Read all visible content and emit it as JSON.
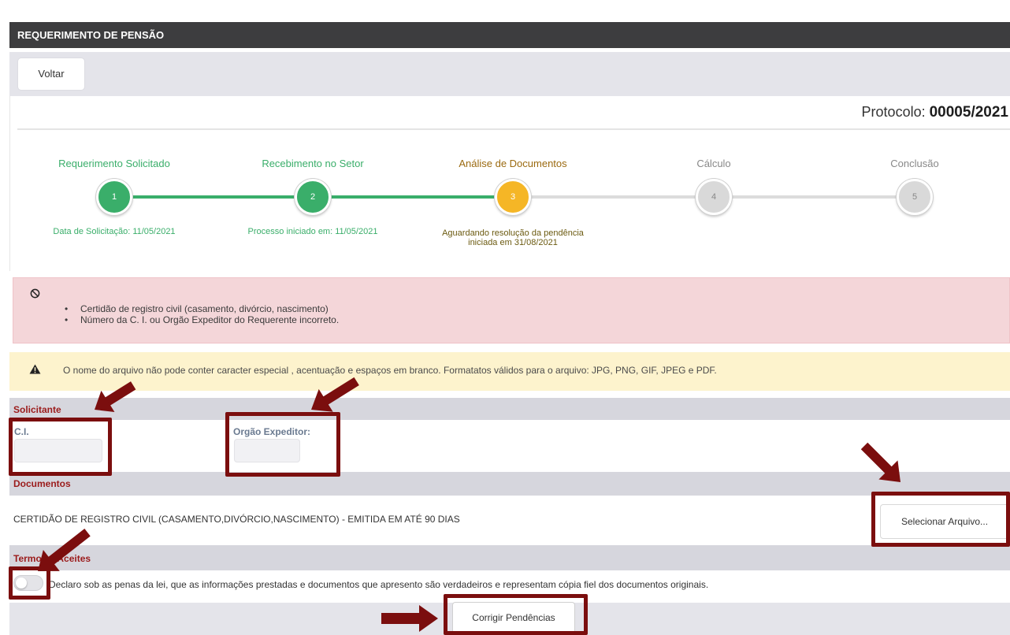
{
  "header": {
    "title": "REQUERIMENTO DE PENSÃO"
  },
  "toolbar": {
    "back_label": "Voltar"
  },
  "protocol": {
    "label": "Protocolo:",
    "number": "00005/2021"
  },
  "steps": [
    {
      "number": "1",
      "title": "Requerimento Solicitado",
      "subtitle": "Data de Solicitação: 11/05/2021",
      "status": "done"
    },
    {
      "number": "2",
      "title": "Recebimento no Setor",
      "subtitle": "Processo iniciado em: 11/05/2021",
      "status": "done"
    },
    {
      "number": "3",
      "title": "Análise de Documentos",
      "subtitle_line1": "Aguardando resolução da pendência",
      "subtitle_line2": "iniciada em 31/08/2021",
      "status": "current"
    },
    {
      "number": "4",
      "title": "Cálculo",
      "status": "pending"
    },
    {
      "number": "5",
      "title": "Conclusão",
      "status": "pending"
    }
  ],
  "pending_alert": {
    "icon": "ban-icon",
    "items": [
      "Certidão de registro civil (casamento, divórcio, nascimento)",
      "Número da C. I. ou Orgão Expeditor do Requerente incorreto."
    ]
  },
  "warning": {
    "icon": "warning-icon",
    "text": "O nome do arquivo não pode conter caracter especial , acentuação e espaços em branco. Formatatos válidos para o arquivo: JPG, PNG, GIF, JPEG e PDF."
  },
  "solicitante": {
    "section_label": "Solicitante",
    "ci_label": "C.I.",
    "ci_value": "",
    "orgao_label": "Orgão Expeditor:",
    "orgao_value": ""
  },
  "documentos": {
    "section_label": "Documentos",
    "doc_name": "CERTIDÃO DE REGISTRO CIVIL (CASAMENTO,DIVÓRCIO,NASCIMENTO) - EMITIDA EM ATÉ 90 DIAS",
    "select_button": "Selecionar Arquivo..."
  },
  "termos": {
    "section_label": "Termos e Aceites",
    "declaration": "Declaro sob as penas da lei, que as informações prestadas e documentos que apresento são verdadeiros e representam cópia fiel dos documentos originais.",
    "accepted": false
  },
  "footer": {
    "submit_label": "Corrigir Pendências"
  },
  "colors": {
    "step_done": "#3aae6a",
    "step_current": "#f5b626",
    "step_pending": "#d9d9d9",
    "section_label": "#9b1b1b",
    "annotation": "#7b0e0e"
  }
}
